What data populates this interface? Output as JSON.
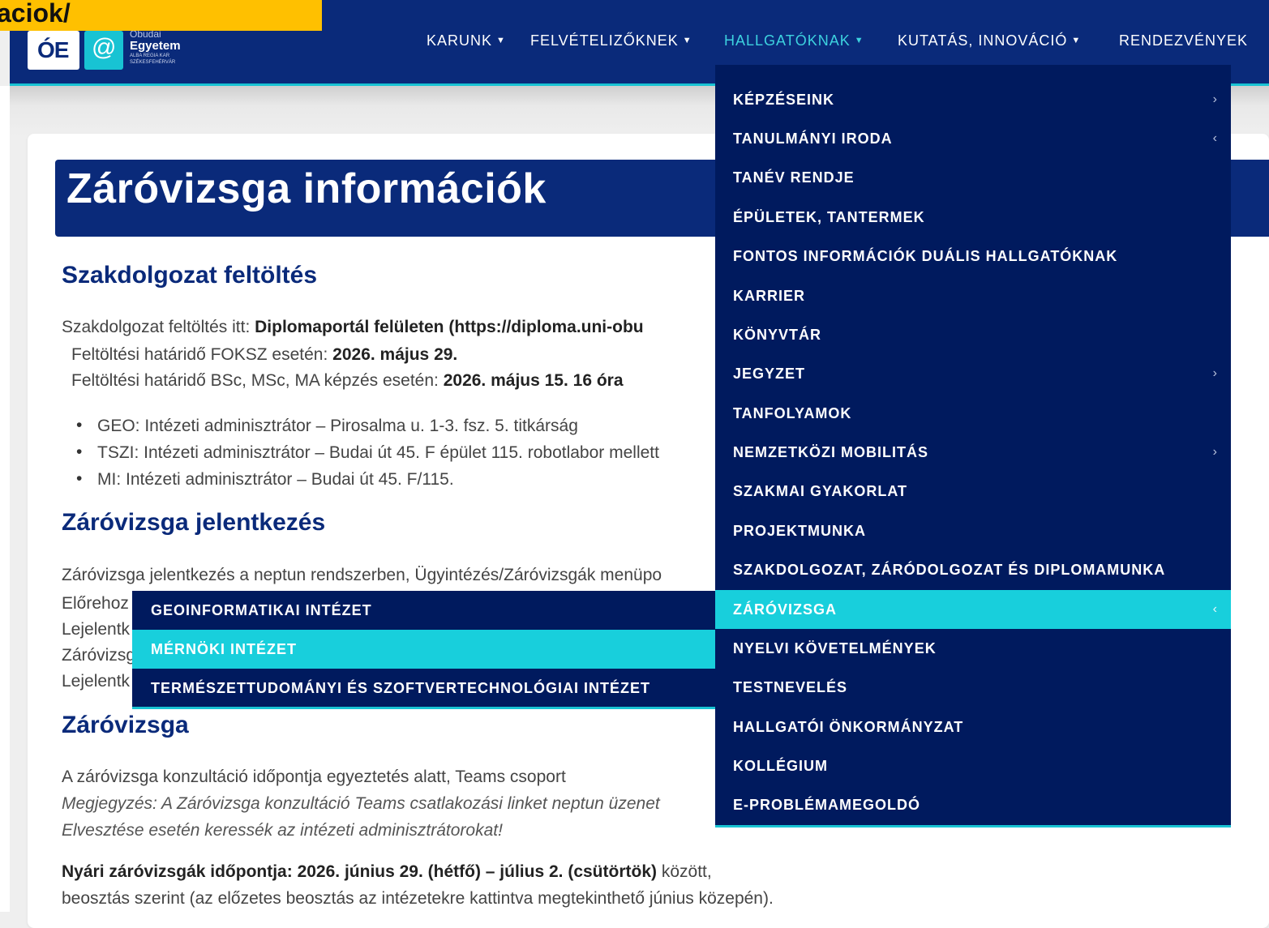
{
  "overlay_tag": "aciok/",
  "logo": {
    "oe_text": "ÓE",
    "at_symbol": "@",
    "line1": "Óbudai",
    "line2": "Egyetem",
    "line3": "ALBA REGIA KAR",
    "line4": "SZÉKESFEHÉRVÁR"
  },
  "nav": [
    {
      "label": "KARUNK"
    },
    {
      "label": "FELVÉTELIZŐKNEK"
    },
    {
      "label": "HALLGATÓKNAK",
      "active": true
    },
    {
      "label": "KUTATÁS, INNOVÁCIÓ"
    },
    {
      "label": "RENDEZVÉNYEK"
    }
  ],
  "dropdown": [
    {
      "label": "KÉPZÉSEINK",
      "arrow": "›"
    },
    {
      "label": "TANULMÁNYI IRODA",
      "arrow": "‹"
    },
    {
      "label": "TANÉV RENDJE",
      "arrow": ""
    },
    {
      "label": "ÉPÜLETEK, TANTERMEK",
      "arrow": ""
    },
    {
      "label": "FONTOS INFORMÁCIÓK DUÁLIS HALLGATÓKNAK",
      "arrow": ""
    },
    {
      "label": "KARRIER",
      "arrow": ""
    },
    {
      "label": "KÖNYVTÁR",
      "arrow": ""
    },
    {
      "label": "JEGYZET",
      "arrow": "›"
    },
    {
      "label": "TANFOLYAMOK",
      "arrow": ""
    },
    {
      "label": "NEMZETKÖZI MOBILITÁS",
      "arrow": "›"
    },
    {
      "label": "SZAKMAI GYAKORLAT",
      "arrow": ""
    },
    {
      "label": "PROJEKTMUNKA",
      "arrow": ""
    },
    {
      "label": "SZAKDOLGOZAT, ZÁRÓDOLGOZAT ÉS DIPLOMAMUNKA",
      "arrow": ""
    },
    {
      "label": "ZÁRÓVIZSGA",
      "arrow": "‹"
    },
    {
      "label": "NYELVI KÖVETELMÉNYEK",
      "arrow": ""
    },
    {
      "label": "TESTNEVELÉS",
      "arrow": ""
    },
    {
      "label": "HALLGATÓI ÖNKORMÁNYZAT",
      "arrow": ""
    },
    {
      "label": "KOLLÉGIUM",
      "arrow": ""
    },
    {
      "label": "E-PROBLÉMAMEGOLDÓ",
      "arrow": ""
    }
  ],
  "submenu": [
    {
      "label": "GEOINFORMATIKAI INTÉZET"
    },
    {
      "label": "MÉRNÖKI INTÉZET"
    },
    {
      "label": "TERMÉSZETTUDOMÁNYI ÉS SZOFTVERTECHNOLÓGIAI INTÉZET"
    }
  ],
  "page": {
    "title": "Záróvizsga információk",
    "sec1": {
      "heading": "Szakdolgozat feltöltés",
      "line1_pre": "Szakdolgozat feltöltés itt: ",
      "line1_bold": "Diplomaportál felületen (https://diploma.uni-obu",
      "line2_pre": "Feltöltési határidő FOKSZ esetén: ",
      "line2_bold": "2026. május 29.",
      "line3_pre": "Feltöltési határidő BSc, MSc, MA képzés esetén: ",
      "line3_bold": "2026. május 15. 16 óra",
      "bullets": [
        "GEO: Intézeti adminisztrátor – Pirosalma u. 1-3. fsz. 5. titkárság",
        "TSZI: Intézeti adminisztrátor – Budai út 45. F épület 115. robotlabor mellett",
        "MI: Intézeti adminisztrátor – Budai út 45. F/115."
      ]
    },
    "sec2": {
      "heading": "Záróvizsga jelentkezés",
      "line1": "Záróvizsga jelentkezés a neptun rendszerben, Ügyintézés/Záróvizsgák menüpo",
      "line2": "Előrehoz",
      "line3": "Lejelentk",
      "line4": "Záróvizsg",
      "line5": "Lejelentk"
    },
    "sec3": {
      "heading": "Záróvizsga",
      "line1": "A záróvizsga konzultáció időpontja egyeztetés alatt, Teams csoport",
      "line2": "Megjegyzés: A Záróvizsga konzultáció Teams csatlakozási linket neptun üzenet",
      "line3": "Elvesztése esetén keressék az intézeti adminisztrátorokat!",
      "line4_bold": "Nyári záróvizsgák időpontja: 2026. június 29. (hétfő) – július 2. (csütörtök)",
      "line4_post": " között,",
      "line5": "beosztás szerint (az előzetes beosztás az intézetekre kattintva megtekinthető június közepén)."
    }
  }
}
